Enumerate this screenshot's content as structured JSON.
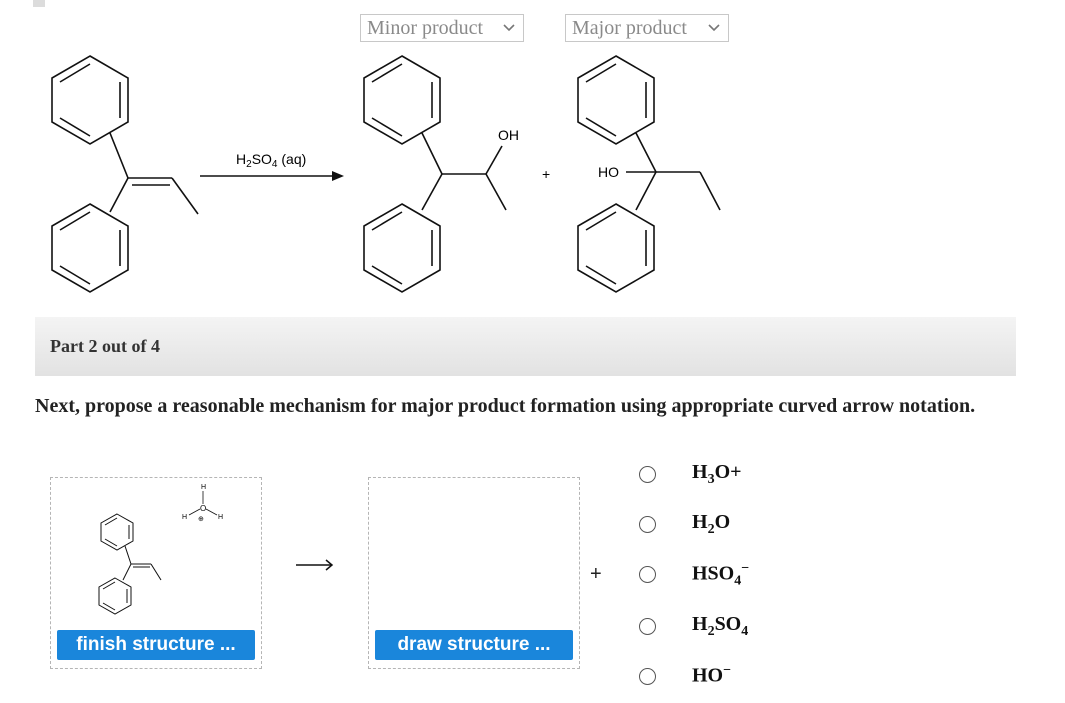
{
  "dropdowns": {
    "minor": {
      "value": "Minor product"
    },
    "major": {
      "value": "Major product"
    }
  },
  "reaction": {
    "reagent_main": "H",
    "reagent_sub1": "2",
    "reagent_mid": "SO",
    "reagent_sub2": "4",
    "reagent_tail": " (aq)",
    "oh_label": "OH",
    "ho_label": "HO",
    "plus": "+"
  },
  "part": {
    "label": "Part 2 out of 4"
  },
  "question": {
    "text": "Next, propose a reasonable mechanism for major product formation using appropriate curved arrow notation."
  },
  "workspace": {
    "finish_button": "finish structure ...",
    "draw_button": "draw structure ...",
    "arrow": "⟶",
    "plus": "+",
    "water_o": "O",
    "water_h": "H",
    "water_charge": "⊕"
  },
  "options": [
    {
      "main": "H",
      "sub": "3",
      "tail": "O+",
      "sup": ""
    },
    {
      "main": "H",
      "sub": "2",
      "tail": "O",
      "sup": ""
    },
    {
      "main": "HSO",
      "sub": "4",
      "tail": "",
      "sup": "−"
    },
    {
      "main": "H",
      "sub": "2",
      "tail": "SO",
      "sub2": "4",
      "sup": ""
    },
    {
      "main": "HO",
      "sub": "",
      "tail": "",
      "sup": "−"
    }
  ],
  "colors": {
    "accent": "#1a86db",
    "banner": "#e6e6e6"
  }
}
